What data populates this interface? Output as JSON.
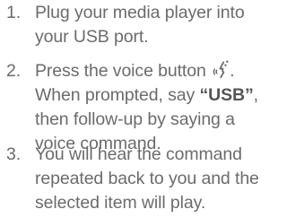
{
  "steps": [
    {
      "number": "1.",
      "lines": [
        "Plug your media player into",
        "your USB port."
      ]
    },
    {
      "number": "2.",
      "line1_prefix": "Press the voice button",
      "line1_suffix": ".",
      "icon": "voice-command-icon",
      "line2_prefix": "When prompted, say ",
      "line2_bold": "“USB”",
      "line2_suffix": ",",
      "line3": "then follow-up by saying a",
      "line4": "voice command."
    },
    {
      "number": "3.",
      "lines": [
        "You will hear the command",
        "repeated back to you and the",
        "selected item will play."
      ]
    }
  ]
}
